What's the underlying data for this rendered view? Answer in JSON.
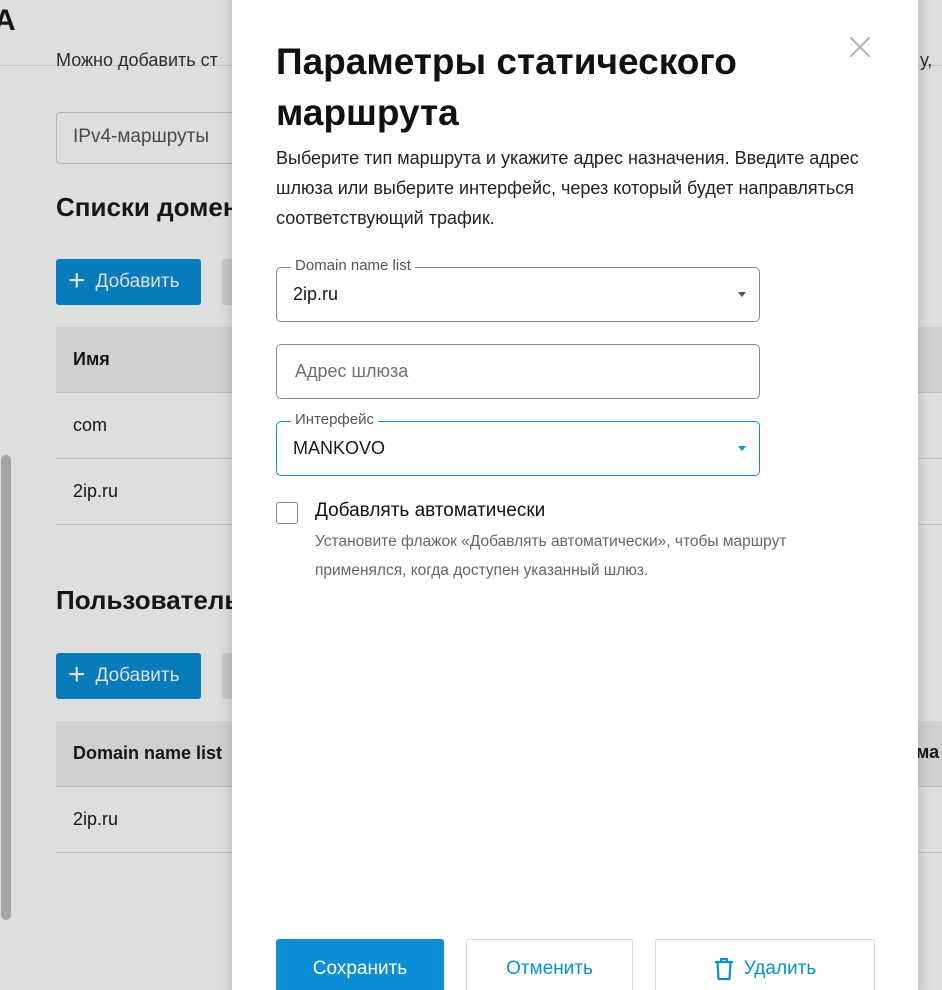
{
  "background": {
    "logo_glyph": "A",
    "intro_text": "Можно добавить ст",
    "intro_text_right": "у,",
    "ipv4_field_value": "IPv4-маршруты",
    "domain_lists": {
      "heading": "Списки домен",
      "add_label": "Добавить",
      "column_header": "Имя",
      "rows": [
        "com",
        "2ip.ru"
      ]
    },
    "user_section": {
      "heading": "Пользователь",
      "add_label": "Добавить",
      "column_header": "Domain name list",
      "column_header_right": "ма",
      "rows": [
        "2ip.ru"
      ]
    }
  },
  "modal": {
    "title": "Параметры статического маршрута",
    "description": "Выберите тип маршрута и укажите адрес назначения. Введите адрес шлюза или выберите интерфейс, через который будет направляться соответствующий трафик.",
    "domain_list_field": {
      "label": "Domain name list",
      "value": "2ip.ru"
    },
    "gateway_field": {
      "placeholder": "Адрес шлюза",
      "value": ""
    },
    "interface_field": {
      "label": "Интерфейс",
      "value": "MANKOVO"
    },
    "auto_add": {
      "label": "Добавлять автоматически",
      "hint": "Установите флажок «Добавлять автоматически», чтобы маршрут применялся, когда доступен указанный шлюз.",
      "checked": false
    },
    "buttons": {
      "save": "Сохранить",
      "cancel": "Отменить",
      "delete": "Удалить"
    }
  },
  "colors": {
    "accent": "#0a8fd6",
    "overlay": "rgba(0,0,0,0.13)"
  },
  "icons": {
    "close": "close-icon",
    "delete": "trash-icon",
    "add": "plus-icon",
    "dropdown": "chevron-down-icon"
  }
}
